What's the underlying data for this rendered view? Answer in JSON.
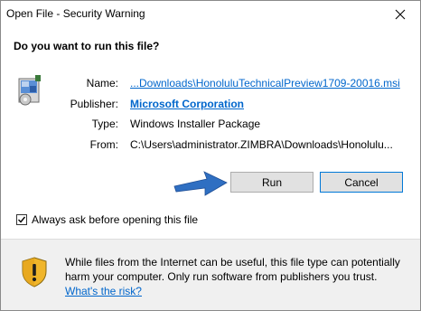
{
  "window": {
    "title": "Open File - Security Warning",
    "close_glyph": "✕"
  },
  "dialog": {
    "heading": "Do you want to run this file?",
    "fields": {
      "name_label": "Name:",
      "name_value": "...Downloads\\HonoluluTechnicalPreview1709-20016.msi",
      "publisher_label": "Publisher:",
      "publisher_value": "Microsoft Corporation",
      "type_label": "Type:",
      "type_value": "Windows Installer Package",
      "from_label": "From:",
      "from_value": "C:\\Users\\administrator.ZIMBRA\\Downloads\\Honolulu..."
    },
    "buttons": {
      "run_label": "Run",
      "cancel_label": "Cancel"
    },
    "checkbox": {
      "label": "Always ask before opening this file",
      "checked": true
    }
  },
  "footer": {
    "text": "While files from the Internet can be useful, this file type can potentially harm your computer. Only run software from publishers you trust.",
    "link": "What's the risk?"
  },
  "icons": {
    "file": "installer-package-icon",
    "shield": "warning-shield-icon",
    "arrow": "pointer-arrow-icon"
  },
  "colors": {
    "link": "#0066cc",
    "arrow": "#2f6fc2",
    "cancel_border": "#0078d7",
    "footer_bg": "#f0f0f0"
  }
}
